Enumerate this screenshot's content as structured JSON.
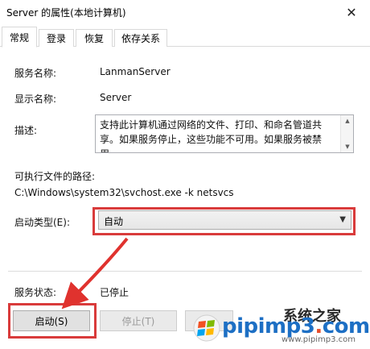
{
  "window": {
    "title": "Server 的属性(本地计算机)",
    "close_icon": "close-icon"
  },
  "tabs": [
    {
      "label": "常规",
      "active": true
    },
    {
      "label": "登录",
      "active": false
    },
    {
      "label": "恢复",
      "active": false
    },
    {
      "label": "依存关系",
      "active": false
    }
  ],
  "general": {
    "service_name_label": "服务名称:",
    "service_name_value": "LanmanServer",
    "display_name_label": "显示名称:",
    "display_name_value": "Server",
    "description_label": "描述:",
    "description_value": "支持此计算机通过网络的文件、打印、和命名管道共享。如果服务停止，这些功能不可用。如果服务被禁用，",
    "exe_path_label": "可执行文件的路径:",
    "exe_path_value": "C:\\Windows\\system32\\svchost.exe -k netsvcs",
    "startup_type_label": "启动类型(E):",
    "startup_type_value": "自动",
    "status_label": "服务状态:",
    "status_value": "已停止"
  },
  "buttons": {
    "start": "启动(S)",
    "stop": "停止(T)",
    "pause": "暂"
  },
  "watermark": {
    "brand": "系统之家",
    "site_prefix": "pipimp3",
    "site_j": ".",
    "site_suffix": "com",
    "url": "www.pipimp3.com"
  },
  "annotation_color": "#d93b3b"
}
